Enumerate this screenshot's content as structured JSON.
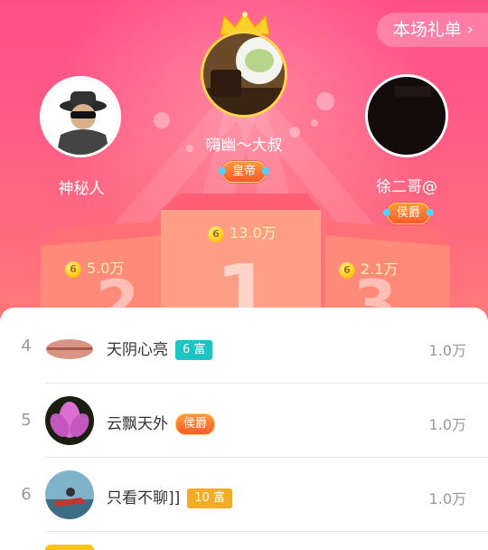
{
  "header": {
    "gift_list_label": "本场礼单"
  },
  "podium": {
    "first": {
      "name": "嗨幽～大叔",
      "badge": "皇帝",
      "value": "13.0万",
      "avatar": "food-photo"
    },
    "second": {
      "name": "神秘人",
      "badge": "",
      "value": "5.0万",
      "avatar": "spy-avatar"
    },
    "third": {
      "name": "徐二哥@",
      "badge": "侯爵",
      "value": "2.1万",
      "avatar": "dark-photo"
    }
  },
  "ranking": [
    {
      "rank": "4",
      "name": "天阴心亮",
      "tag": "6 富",
      "tag_color": "#1ec4c4",
      "value": "1.0万",
      "avatar": "lips-photo"
    },
    {
      "rank": "5",
      "name": "云飘天外",
      "tag": "侯爵",
      "tag_color": "#ff6a2a",
      "value": "1.0万",
      "avatar": "lotus-photo"
    },
    {
      "rank": "6",
      "name": "只看不聊]]",
      "tag": "10 富",
      "tag_color": "#f3ac2a",
      "value": "1.0万",
      "avatar": "jetski-photo"
    }
  ],
  "coin_glyph": "6",
  "colors": {
    "hero_top": "#ff4f88",
    "hero_bottom": "#ff7a79",
    "value_text": "#fff3a8"
  }
}
